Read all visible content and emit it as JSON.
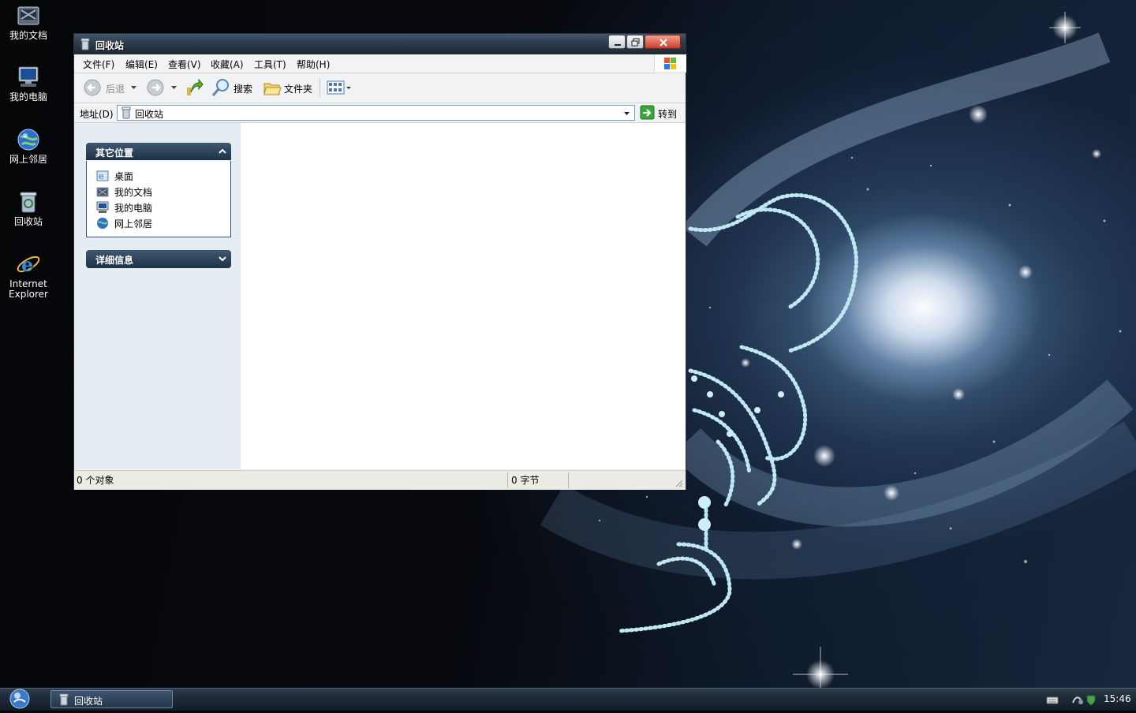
{
  "desktop": {
    "icons": [
      {
        "label": "我的文档",
        "icon": "my-documents-icon"
      },
      {
        "label": "我的电脑",
        "icon": "my-computer-icon"
      },
      {
        "label": "网上邻居",
        "icon": "network-places-icon"
      },
      {
        "label": "回收站",
        "icon": "recycle-bin-icon"
      },
      {
        "label_line1": "Internet",
        "label_line2": "Explorer",
        "icon": "internet-explorer-icon"
      }
    ]
  },
  "window": {
    "title": "回收站",
    "menu": [
      "文件(F)",
      "编辑(E)",
      "查看(V)",
      "收藏(A)",
      "工具(T)",
      "帮助(H)"
    ],
    "toolbar": {
      "back": "后退",
      "search": "搜索",
      "folders": "文件夹"
    },
    "address": {
      "label": "地址(D)",
      "value": "回收站",
      "go": "转到"
    },
    "taskpane": {
      "other_places": {
        "title": "其它位置",
        "items": [
          {
            "label": "桌面",
            "icon": "desktop-icon"
          },
          {
            "label": "我的文档",
            "icon": "my-documents-icon"
          },
          {
            "label": "我的电脑",
            "icon": "my-computer-icon"
          },
          {
            "label": "网上邻居",
            "icon": "network-places-icon"
          }
        ]
      },
      "details": {
        "title": "详细信息"
      }
    },
    "status": {
      "objects": "0 个对象",
      "size": "0 字节"
    }
  },
  "taskbar": {
    "task": "回收站",
    "clock": "15:46"
  },
  "colors": {
    "title_bar": "#2f3d4e",
    "panel_header": "#2a4259",
    "taskpane_bg": "#e5edf2",
    "taskbar": "#1c2836"
  }
}
